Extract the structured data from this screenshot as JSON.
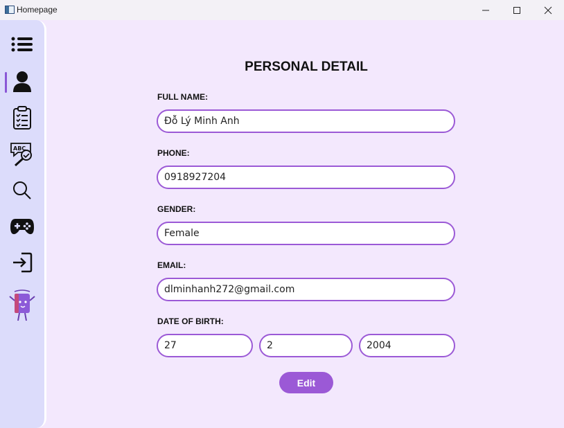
{
  "window": {
    "title": "Homepage"
  },
  "sidebar": {
    "items": [
      {
        "icon": "menu-list-icon",
        "active": false
      },
      {
        "icon": "user-icon",
        "active": true
      },
      {
        "icon": "clipboard-checklist-icon",
        "active": false
      },
      {
        "icon": "abc-spellcheck-icon",
        "active": false
      },
      {
        "icon": "search-icon",
        "active": false
      },
      {
        "icon": "gamepad-icon",
        "active": false
      },
      {
        "icon": "logout-icon",
        "active": false
      },
      {
        "icon": "book-mascot-icon",
        "active": false
      }
    ]
  },
  "form": {
    "title": "PERSONAL DETAIL",
    "full_name_label": "FULL NAME:",
    "full_name": "Đỗ Lý Minh Anh",
    "phone_label": "PHONE:",
    "phone": "0918927204",
    "gender_label": "GENDER:",
    "gender": "Female",
    "email_label": "EMAIL:",
    "email": "dlminhanh272@gmail.com",
    "dob_label": "DATE OF BIRTH:",
    "dob_day": "27",
    "dob_month": "2",
    "dob_year": "2004",
    "edit_label": "Edit"
  },
  "colors": {
    "accent": "#9b59d6",
    "background": "#f3e8fd",
    "sidebar": "#dcdcfb"
  }
}
